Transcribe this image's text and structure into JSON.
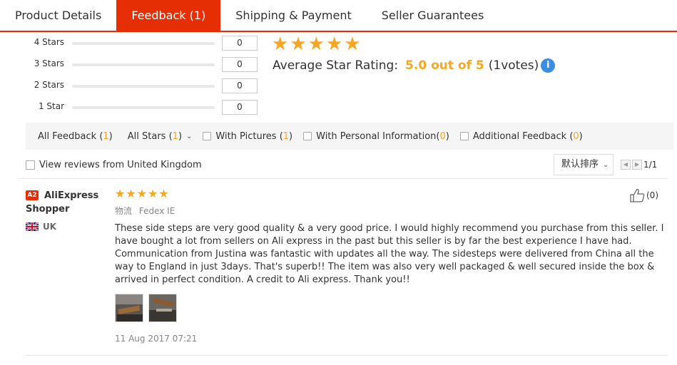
{
  "tabs": [
    {
      "label": "Product Details",
      "active": false
    },
    {
      "label": "Feedback (1)",
      "active": true
    },
    {
      "label": "Shipping & Payment",
      "active": false
    },
    {
      "label": "Seller Guarantees",
      "active": false
    }
  ],
  "distribution": [
    {
      "label": "4 Stars",
      "count": "0"
    },
    {
      "label": "3 Stars",
      "count": "0"
    },
    {
      "label": "2 Stars",
      "count": "0"
    },
    {
      "label": "1 Star",
      "count": "0"
    }
  ],
  "average": {
    "stars": 5,
    "label": "Average Star Rating:",
    "score": "5.0 out of 5",
    "votes_open": "(",
    "votes_count": "1",
    "votes_close": "votes)",
    "info_icon": "info-icon"
  },
  "filters": {
    "all_feedback": {
      "label": "All Feedback",
      "count": "1"
    },
    "all_stars": {
      "label": "All Stars",
      "count": "1"
    },
    "with_pictures": {
      "label": "With Pictures",
      "count": "1"
    },
    "personal_info": {
      "label": "With Personal Information",
      "count": "0"
    },
    "additional": {
      "label": "Additional Feedback",
      "count": "0"
    }
  },
  "country_filter": {
    "label": "View reviews from United Kingdom"
  },
  "sort": {
    "label": "默认排序"
  },
  "pager": {
    "text": "1/1"
  },
  "review": {
    "badge": "A2",
    "buyer": "AliExpress Shopper",
    "country": "UK",
    "stars": 5,
    "logistics_label": "物流",
    "logistics_value": "Fedex IE",
    "text": "These side steps are very good quality & a very good price. I would highly recommend you purchase from this seller. I have bought a lot from sellers on Ali express in the past but this seller is by far the best experience I have had. Communication from Justina was fantastic with updates all the way. The sidesteps were delivered from China all the way to England in just 3days. That's superb!! The item was also very well packaged & well secured inside the box & arrived in perfect condition. A credit to Ali express. Thank you!!",
    "date": "11 Aug 2017 07:21",
    "helpful": "(0)"
  },
  "colors": {
    "accent": "#e62e04",
    "star": "#f5a623",
    "info": "#3d8ee0"
  }
}
